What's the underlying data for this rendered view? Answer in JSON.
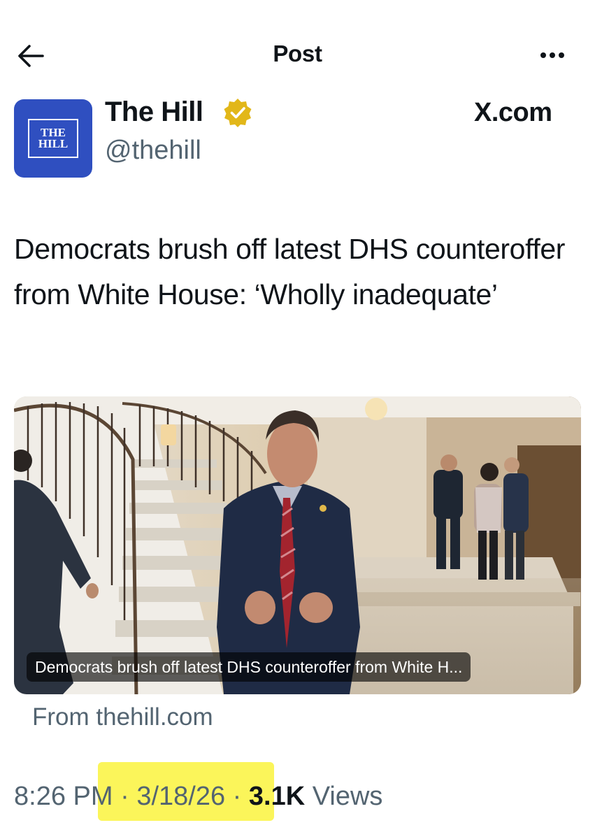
{
  "header": {
    "title": "Post",
    "back_icon": "arrow-left-icon",
    "more_icon": "more-horizontal-icon"
  },
  "author": {
    "name": "The Hill",
    "handle": "@thehill",
    "verified_badge": "verified-badge-gold",
    "avatar_line1": "THE",
    "avatar_line2": "HILL",
    "brand_color": "#2f4fc0"
  },
  "watermark": "X.com",
  "post": {
    "text": "Democrats brush off latest DHS counteroffer from White House: ‘Wholly inadequate’"
  },
  "link_card": {
    "caption": "Democrats brush off latest DHS counteroffer from White H...",
    "source": "From thehill.com"
  },
  "meta": {
    "time": "8:26 PM",
    "sep1": " · ",
    "date": "3/18/26",
    "sep2": " · ",
    "views_count": "3.1K",
    "views_label": " Views",
    "highlight_color": "#fbf55a"
  }
}
